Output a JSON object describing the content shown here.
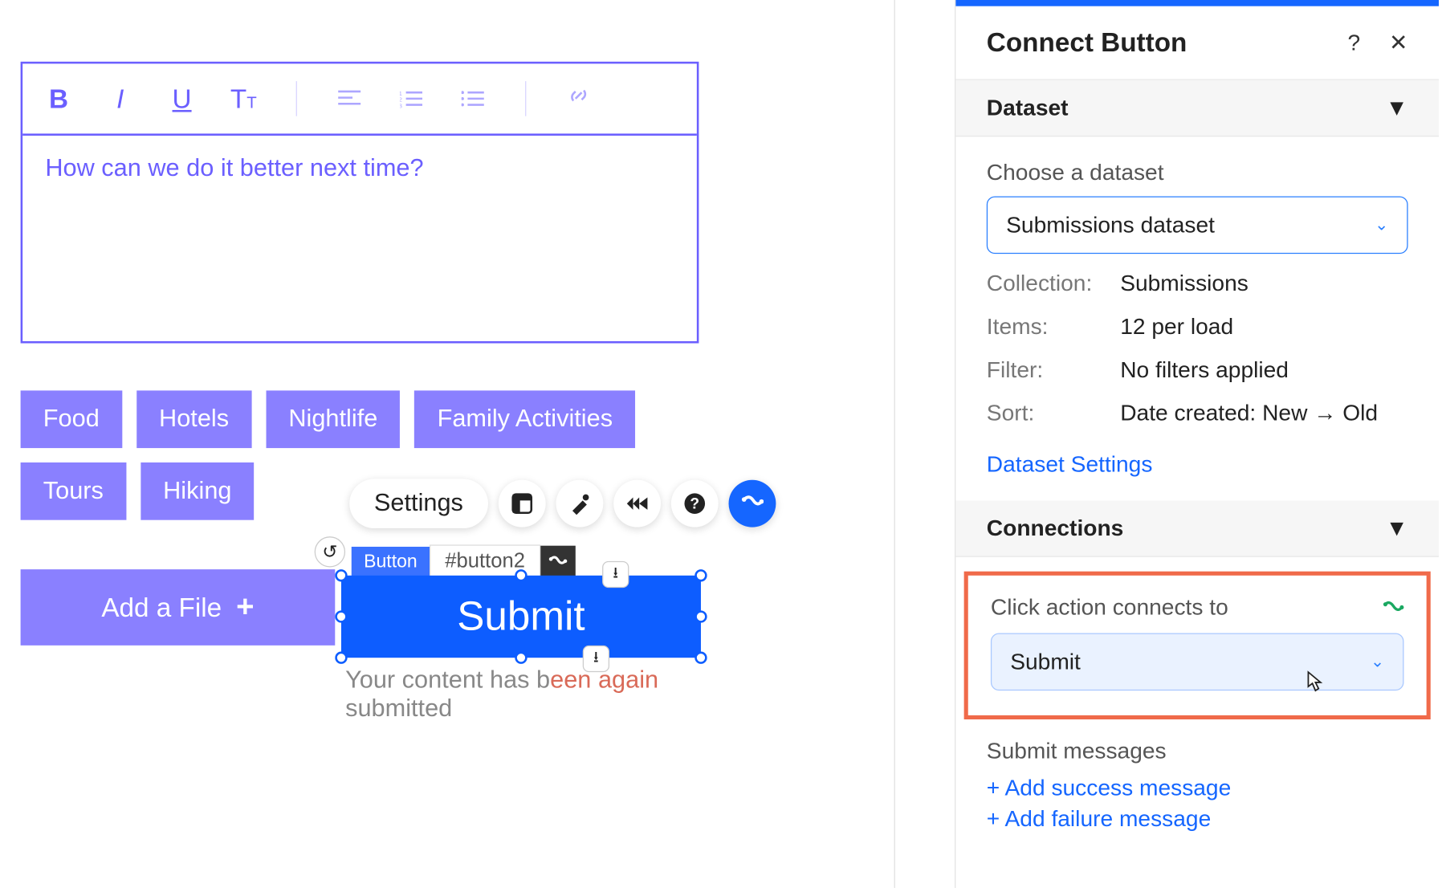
{
  "editor": {
    "placeholder_text": "How can we do it better next time?"
  },
  "tags": [
    "Food",
    "Hotels",
    "Nightlife",
    "Family Activities",
    "Tours",
    "Hiking"
  ],
  "add_file_label": "Add a File",
  "float_toolbar": {
    "settings": "Settings"
  },
  "selected_element": {
    "type_label": "Button",
    "id_label": "#button2"
  },
  "submit_button_label": "Submit",
  "messages": {
    "line1_left": "Your content has b",
    "line1_mid_red": "een",
    "line1_right_red": "again",
    "line2": "submitted"
  },
  "panel": {
    "title": "Connect Button",
    "sections": {
      "dataset": {
        "title": "Dataset",
        "choose_label": "Choose a dataset",
        "selected": "Submissions dataset",
        "collection_k": "Collection:",
        "collection_v": "Submissions",
        "items_k": "Items:",
        "items_v": "12 per load",
        "filter_k": "Filter:",
        "filter_v": "No filters applied",
        "sort_k": "Sort:",
        "sort_v": "Date created: New → Old",
        "settings_link": "Dataset Settings"
      },
      "connections": {
        "title": "Connections",
        "click_label": "Click action connects to",
        "click_value": "Submit",
        "submit_msgs_title": "Submit messages",
        "add_success": "+ Add success message",
        "add_failure": "+ Add failure message"
      }
    }
  }
}
